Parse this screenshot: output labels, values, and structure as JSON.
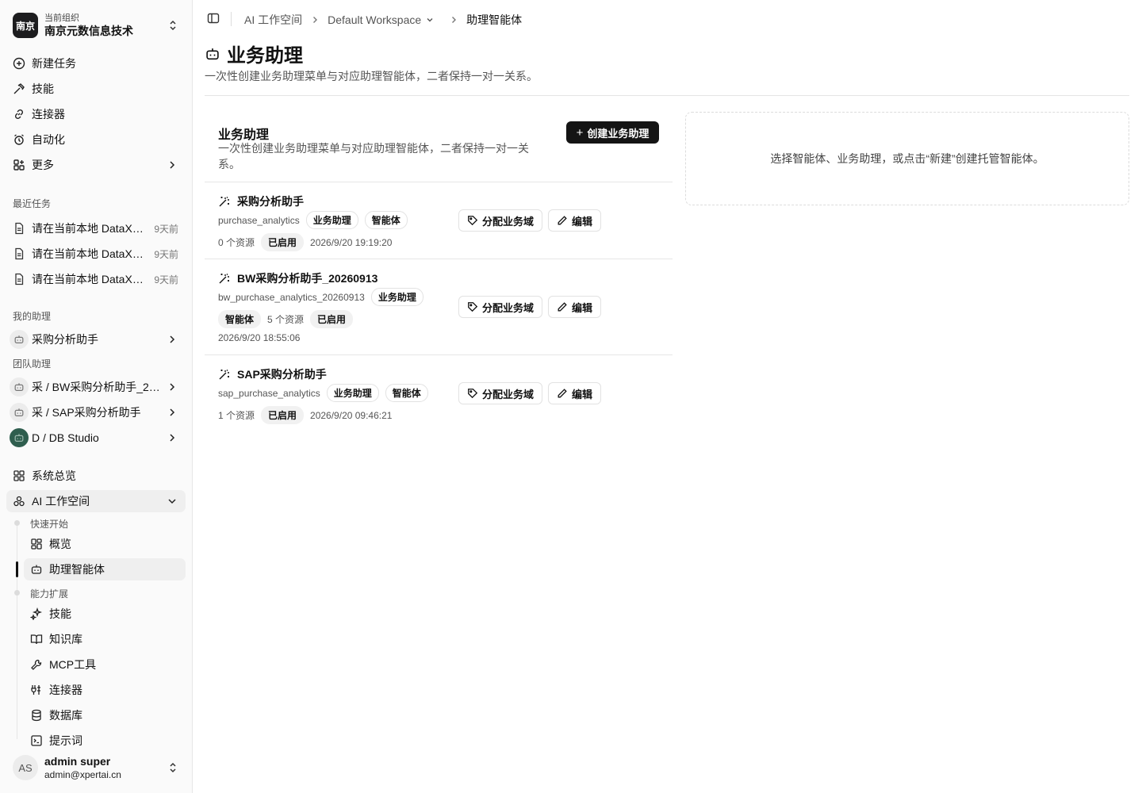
{
  "org": {
    "logo_text": "南京",
    "subtitle": "当前组织",
    "name": "南京元数信息技术"
  },
  "nav": {
    "new_task": "新建任务",
    "skills": "技能",
    "connectors": "连接器",
    "automation": "自动化",
    "more": "更多"
  },
  "recent": {
    "label": "最近任务",
    "items": [
      {
        "title": "请在当前本地 DataXp…",
        "when": "9天前"
      },
      {
        "title": "请在当前本地 DataXp…",
        "when": "9天前"
      },
      {
        "title": "请在当前本地 DataXp…",
        "when": "9天前"
      }
    ]
  },
  "my_assistants": {
    "label": "我的助理",
    "items": [
      "采购分析助手"
    ]
  },
  "team_assistants": {
    "label": "团队助理",
    "items": [
      "采 / BW采购分析助手_2…",
      "采 / SAP采购分析助手",
      "D / DB Studio"
    ]
  },
  "system": {
    "overview": "系统总览",
    "ai_workspace": "AI 工作空间",
    "quick_start": "快速开始",
    "overview_sub": "概览",
    "assistant_agents": "助理智能体",
    "capabilities": "能力扩展",
    "skills": "技能",
    "knowledge": "知识库",
    "mcp": "MCP工具",
    "connectors": "连接器",
    "database": "数据库",
    "prompts": "提示词"
  },
  "user": {
    "initials": "AS",
    "name": "admin super",
    "email": "admin@xpertai.cn"
  },
  "breadcrumb": {
    "root": "AI 工作空间",
    "workspace": "Default Workspace",
    "current": "助理智能体"
  },
  "page": {
    "title": "业务助理",
    "description": "一次性创建业务助理菜单与对应助理智能体，二者保持一对一关系。"
  },
  "list": {
    "title": "业务助理",
    "description": "一次性创建业务助理菜单与对应助理智能体，二者保持一对一关系。",
    "create_label": "创建业务助理",
    "assign_label": "分配业务域",
    "edit_label": "编辑",
    "items": [
      {
        "name": "采购分析助手",
        "code": "purchase_analytics",
        "tag1": "业务助理",
        "tag2": "智能体",
        "resources": "0 个资源",
        "status": "已启用",
        "time": "2026/9/20 19:19:20"
      },
      {
        "name": "BW采购分析助手_20260913",
        "code": "bw_purchase_analytics_20260913",
        "tag1": "业务助理",
        "tag2": "智能体",
        "resources": "5 个资源",
        "status": "已启用",
        "time": "2026/9/20 18:55:06"
      },
      {
        "name": "SAP采购分析助手",
        "code": "sap_purchase_analytics",
        "tag1": "业务助理",
        "tag2": "智能体",
        "resources": "1 个资源",
        "status": "已启用",
        "time": "2026/9/20 09:46:21"
      }
    ]
  },
  "empty_panel": {
    "text": "选择智能体、业务助理，或点击“新建”创建托管智能体。"
  },
  "colors": {
    "primary_button": "#141414",
    "sidebar_bg": "#fafafa",
    "accent_green": "#2f5e4e"
  }
}
